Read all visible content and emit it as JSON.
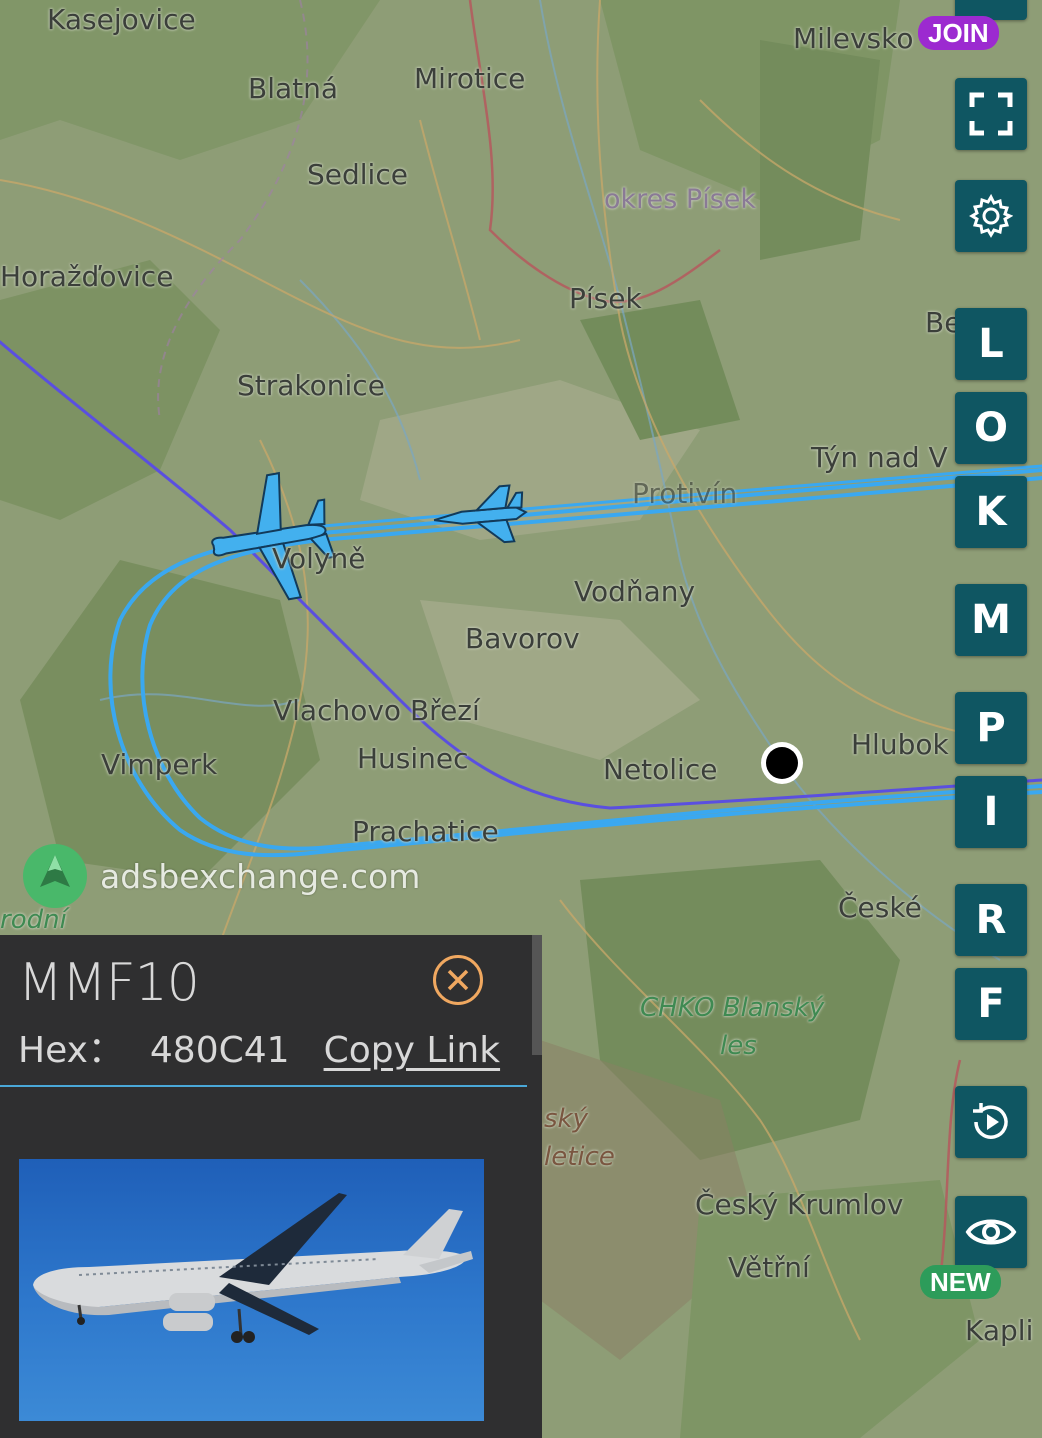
{
  "map": {
    "places": [
      {
        "name": "Kasejovice",
        "cls": ""
      },
      {
        "name": "Blatná",
        "cls": ""
      },
      {
        "name": "Mirotice",
        "cls": ""
      },
      {
        "name": "Milevsko",
        "cls": ""
      },
      {
        "name": "Sedlice",
        "cls": ""
      },
      {
        "name": "okres Písek",
        "cls": "region"
      },
      {
        "name": "Horažďovice",
        "cls": ""
      },
      {
        "name": "Písek",
        "cls": ""
      },
      {
        "name": "Strakonice",
        "cls": ""
      },
      {
        "name": "Týn nad V",
        "cls": ""
      },
      {
        "name": "Volyně",
        "cls": ""
      },
      {
        "name": "Protivín",
        "cls": ""
      },
      {
        "name": "Vodňany",
        "cls": ""
      },
      {
        "name": "Bavorov",
        "cls": ""
      },
      {
        "name": "Vlachovo Březí",
        "cls": ""
      },
      {
        "name": "Vimperk",
        "cls": ""
      },
      {
        "name": "Husinec",
        "cls": ""
      },
      {
        "name": "Netolice",
        "cls": ""
      },
      {
        "name": "Hlubok",
        "cls": ""
      },
      {
        "name": "Prachatice",
        "cls": ""
      },
      {
        "name": "České",
        "cls": ""
      },
      {
        "name": "CHKO Blanský",
        "cls": "park"
      },
      {
        "name": "les",
        "cls": "park"
      },
      {
        "name": "ský",
        "cls": "park2"
      },
      {
        "name": "letice",
        "cls": "park2"
      },
      {
        "name": "Český Krumlov",
        "cls": ""
      },
      {
        "name": "Větřní",
        "cls": ""
      },
      {
        "name": "Kapli",
        "cls": ""
      },
      {
        "name": "rodní",
        "cls": "park"
      },
      {
        "name": "Be",
        "cls": ""
      }
    ],
    "track_colors": {
      "primary": "#3aa8f0",
      "secondary": "#5a4fe0"
    },
    "brand_text": "adsbexchange.com"
  },
  "toolbar": {
    "join_label": "JOIN",
    "new_label": "NEW",
    "letters": [
      "L",
      "O",
      "K",
      "M",
      "P",
      "I",
      "R",
      "F"
    ]
  },
  "panel": {
    "callsign": "MMF10",
    "hex_label": "Hex：",
    "hex_value": "480C41",
    "copy_link_label": "Copy Link"
  },
  "colors": {
    "button_bg": "#0f5662",
    "join_bg": "#9c2ad0",
    "new_bg": "#2d9c5a",
    "panel_bg": "#2f2f30",
    "close_accent": "#f0a860"
  }
}
